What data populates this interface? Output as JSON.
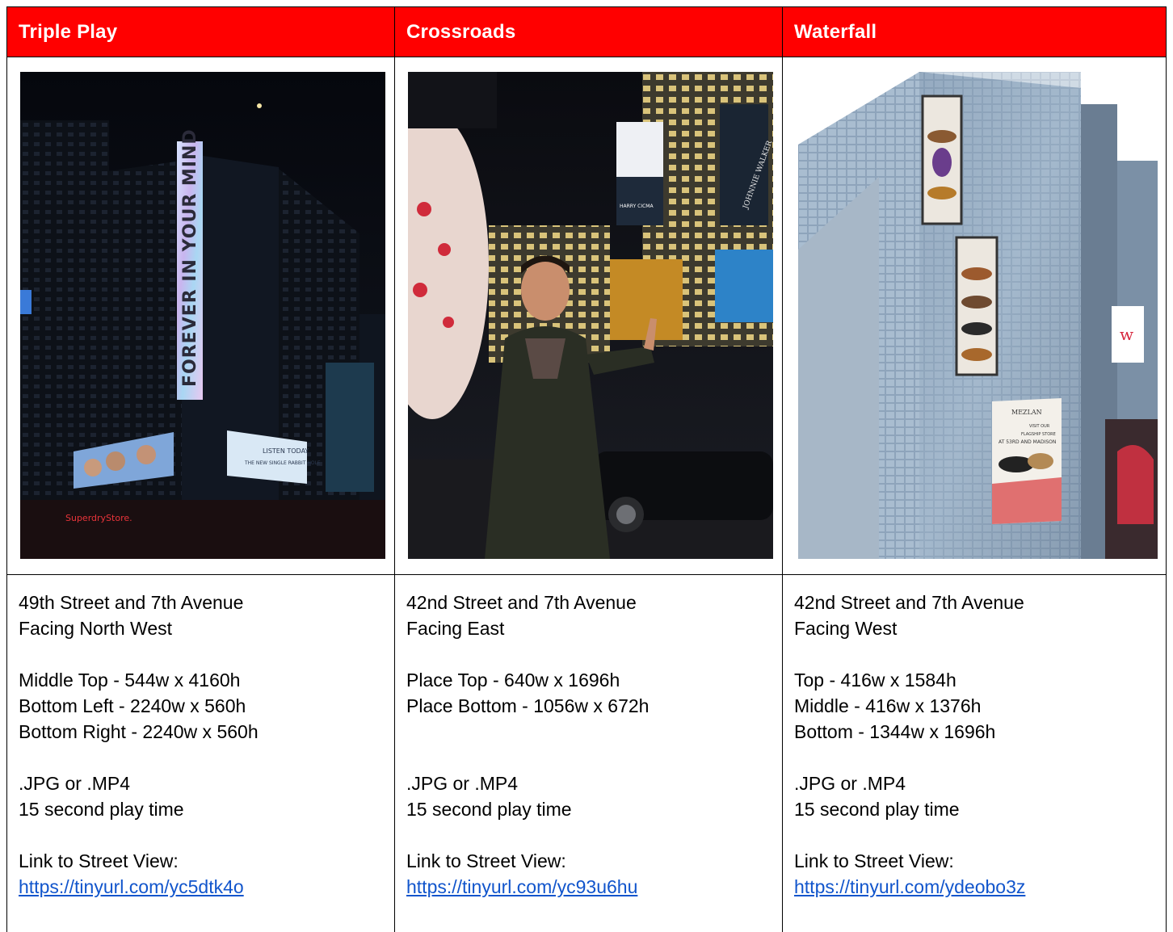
{
  "columns": [
    {
      "name": "Triple Play",
      "address": "49th Street and 7th Avenue",
      "facing": "Facing North West",
      "sizes": [
        "Middle Top - 544w x 4160h",
        "Bottom Left - 2240w x 560h",
        "Bottom Right - 2240w x 560h"
      ],
      "format": ".JPG or .MP4",
      "play_time": "15 second play time",
      "link_label": "Link to Street View:",
      "link": "https://tinyurl.com/yc5dtk4o",
      "photo_text": {
        "vertical": "FOREVER IN YOUR MIND",
        "billboard_right": "LISTEN TODAY",
        "billboard_right_2": "THE NEW SINGLE RABBIT HOLE",
        "store": "SuperdryStore."
      }
    },
    {
      "name": "Crossroads",
      "address": "42nd Street and 7th Avenue",
      "facing": "Facing East",
      "sizes": [
        "Place Top - 640w x 1696h",
        "Place Bottom - 1056w x 672h"
      ],
      "format": ".JPG or .MP4",
      "play_time": "15 second play time",
      "link_label": "Link to Street View:",
      "link": "https://tinyurl.com/yc93u6hu",
      "photo_text": {
        "brand": "HARRY CICMA",
        "walker": "JOHNNIE WALKER"
      }
    },
    {
      "name": "Waterfall",
      "address": "42nd Street and 7th Avenue",
      "facing": "Facing West",
      "sizes": [
        "Top - 416w x 1584h",
        "Middle - 416w x 1376h",
        "Bottom - 1344w x 1696h"
      ],
      "format": ".JPG or .MP4",
      "play_time": "15 second play time",
      "link_label": "Link to Street View:",
      "link": "https://tinyurl.com/ydeobo3z",
      "photo_text": {
        "brand": "MEZLAN",
        "line1": "VISIT OUR",
        "line2": "FLAGSHIP STORE",
        "line3": "AT 53RD AND MADISON"
      }
    }
  ],
  "colors": {
    "header_bg": "#ff0000",
    "header_text": "#ffffff",
    "link": "#1155cc"
  }
}
